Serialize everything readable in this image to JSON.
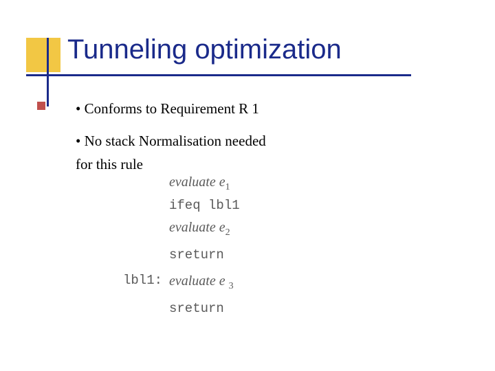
{
  "slide": {
    "title": "Tunneling optimization",
    "bullets": [
      "• Conforms to Requirement R 1",
      "• No stack Normalisation needed",
      "for this rule"
    ],
    "code": {
      "rows": [
        {
          "label": "",
          "instr_italic": "evaluate e",
          "sub": "1",
          "instr_mono": ""
        },
        {
          "label": "",
          "instr_italic": "",
          "sub": "",
          "instr_mono": "ifeq lbl1"
        },
        {
          "label": "",
          "instr_italic": "evaluate e",
          "sub": "2",
          "instr_mono": ""
        },
        {
          "label": "",
          "instr_italic": "",
          "sub": "",
          "instr_mono": "sreturn"
        },
        {
          "label": "lbl1:",
          "instr_italic": "evaluate e ",
          "sub": "3",
          "instr_mono": ""
        },
        {
          "label": "",
          "instr_italic": "",
          "sub": "",
          "instr_mono": "sreturn"
        }
      ]
    }
  }
}
